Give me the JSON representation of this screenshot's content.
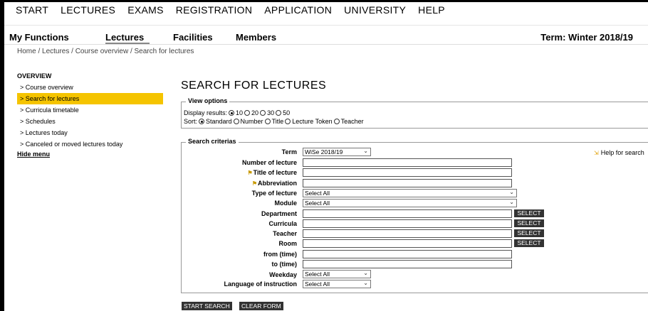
{
  "topnav": [
    "START",
    "LECTURES",
    "EXAMS",
    "REGISTRATION",
    "APPLICATION",
    "UNIVERSITY",
    "HELP"
  ],
  "subnav": {
    "items": [
      "My Functions",
      "Lectures",
      "Facilities",
      "Members"
    ],
    "term": "Term: Winter 2018/19"
  },
  "breadcrumb": "Home  / Lectures / Course overview / Search for lectures",
  "sidebar": {
    "heading": "OVERVIEW",
    "items": [
      "> Course overview",
      "> Search for lectures",
      "> Curricula timetable",
      "> Schedules",
      "> Lectures today",
      "> Canceled or moved lectures today"
    ],
    "hide": "Hide menu"
  },
  "page_title": "SEARCH FOR LECTURES",
  "view_options": {
    "title": "View options",
    "display_label": "Display results:",
    "display_options": [
      "10",
      "20",
      "30",
      "50"
    ],
    "display_selected": "10",
    "sort_label": "Sort:",
    "sort_options": [
      "Standard",
      "Number",
      "Title",
      "Lecture Token",
      "Teacher"
    ],
    "sort_selected": "Standard"
  },
  "criteria": {
    "title": "Search criterias",
    "term_label": "Term",
    "term_value": "WiSe 2018/19",
    "number_label": "Number of lecture",
    "title_label": "Title of lecture",
    "abbrev_label": "Abbreviation",
    "type_label": "Type of lecture",
    "type_value": "Select All",
    "module_label": "Module",
    "module_value": "Select All",
    "department_label": "Department",
    "curricula_label": "Curricula",
    "teacher_label": "Teacher",
    "room_label": "Room",
    "from_label": "from (time)",
    "to_label": "to (time)",
    "weekday_label": "Weekday",
    "weekday_value": "Select All",
    "language_label": "Language of instruction",
    "language_value": "Select All",
    "select_button": "SELECT",
    "help": "Help for search"
  },
  "buttons": {
    "start_search": "START SEARCH",
    "clear_form": "CLEAR FORM"
  }
}
